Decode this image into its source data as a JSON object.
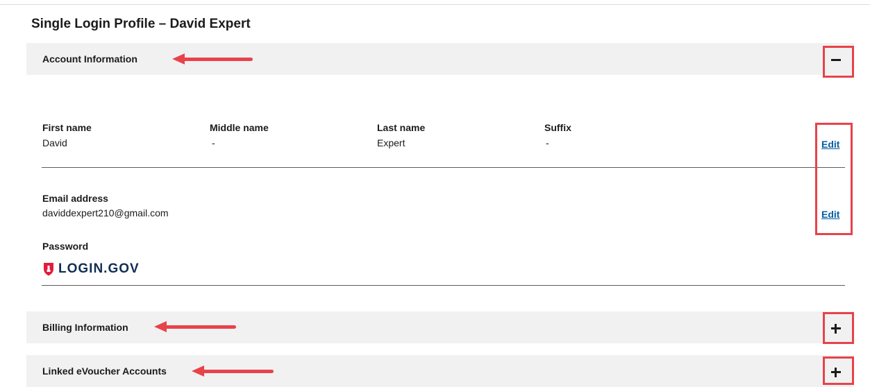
{
  "page": {
    "title": "Single Login Profile – David Expert"
  },
  "sections": {
    "account": {
      "label": "Account Information",
      "toggle": "−"
    },
    "billing": {
      "label": "Billing Information",
      "toggle": "+"
    },
    "evoucher": {
      "label": "Linked eVoucher Accounts",
      "toggle": "+"
    }
  },
  "name_fields": {
    "first": {
      "label": "First name",
      "value": "David"
    },
    "middle": {
      "label": "Middle name",
      "value": "-"
    },
    "last": {
      "label": "Last name",
      "value": "Expert"
    },
    "suffix": {
      "label": "Suffix",
      "value": "-"
    },
    "edit_label": "Edit"
  },
  "email": {
    "label": "Email address",
    "value": "daviddexpert210@gmail.com",
    "edit_label": "Edit"
  },
  "password": {
    "label": "Password",
    "provider_logo_text": "LOGIN.GOV"
  },
  "colors": {
    "annotation": "#e8424a",
    "link": "#005ea2",
    "section_bg": "#f1f1f1",
    "logo_red": "#e21c3d",
    "logo_navy": "#112e51"
  },
  "icons": {
    "collapse": "minus-icon",
    "expand": "plus-icon",
    "logo": "login-gov-shield-icon"
  }
}
